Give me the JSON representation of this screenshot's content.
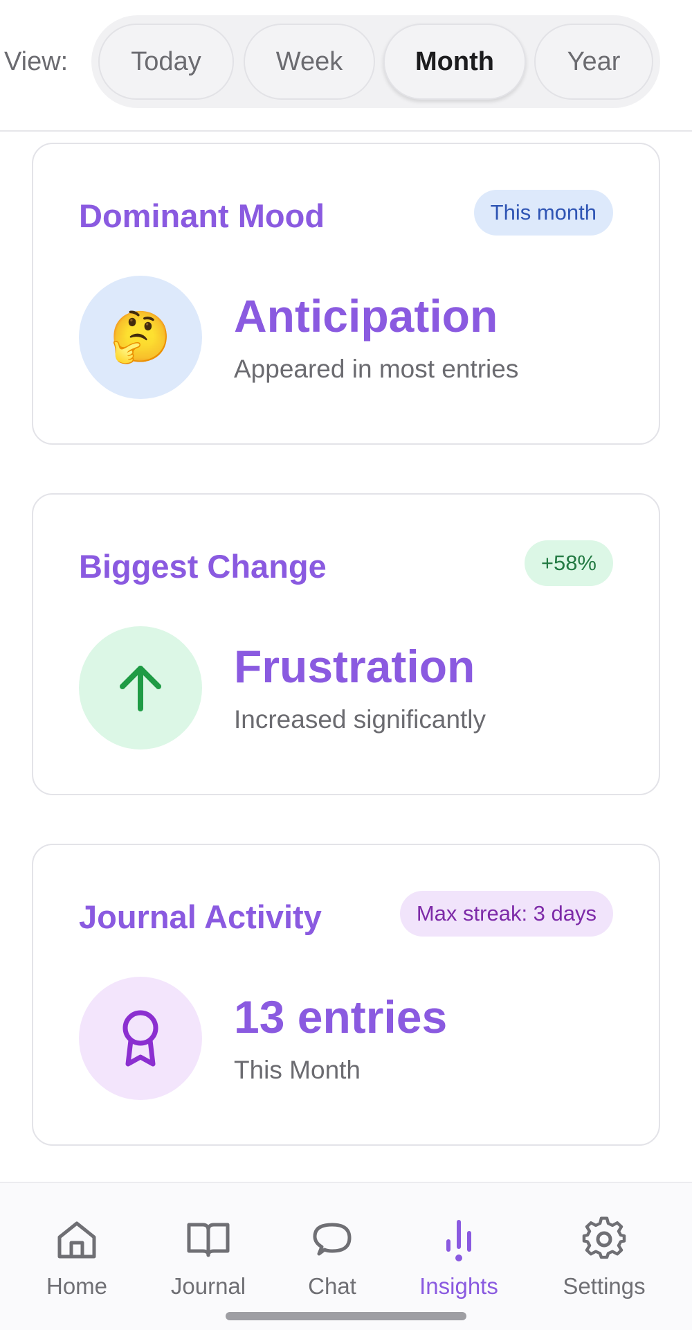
{
  "view_selector": {
    "label": "View:",
    "options": [
      "Today",
      "Week",
      "Month",
      "Year"
    ],
    "selected": "Month"
  },
  "cards": [
    {
      "title": "Dominant Mood",
      "badge": "This month",
      "icon": "thinking-face-emoji",
      "emoji": "🤔",
      "value": "Anticipation",
      "subtitle": "Appeared in most entries"
    },
    {
      "title": "Biggest Change",
      "badge": "+58%",
      "icon": "arrow-up-icon",
      "value": "Frustration",
      "subtitle": "Increased significantly"
    },
    {
      "title": "Journal Activity",
      "badge": "Max streak: 3 days",
      "icon": "award-ribbon-icon",
      "value": "13 entries",
      "subtitle": "This Month"
    }
  ],
  "nav": {
    "items": [
      {
        "label": "Home",
        "icon": "home-icon"
      },
      {
        "label": "Journal",
        "icon": "book-icon"
      },
      {
        "label": "Chat",
        "icon": "chat-bubble-icon"
      },
      {
        "label": "Insights",
        "icon": "bar-chart-icon"
      },
      {
        "label": "Settings",
        "icon": "gear-icon"
      }
    ],
    "active": "Insights"
  },
  "colors": {
    "accent": "#8a5ae0",
    "blue_badge_bg": "#dde9fb",
    "green_badge_bg": "#dcf7e6",
    "purple_badge_bg": "#f1e4fb",
    "green_arrow": "#1f9b45",
    "purple_icon": "#8b2fd0"
  }
}
